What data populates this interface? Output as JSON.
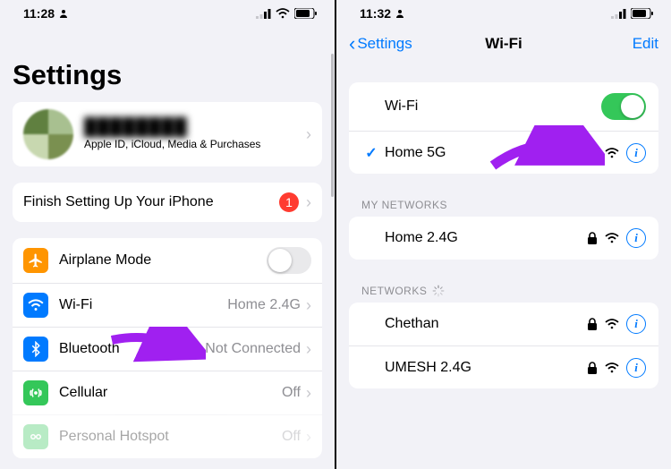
{
  "left": {
    "status": {
      "time": "11:28"
    },
    "title": "Settings",
    "profile": {
      "name": "████████",
      "subtitle": "Apple ID, iCloud, Media & Purchases"
    },
    "finish_setup": {
      "label": "Finish Setting Up Your iPhone",
      "badge": "1"
    },
    "rows": {
      "airplane": {
        "label": "Airplane Mode"
      },
      "wifi": {
        "label": "Wi-Fi",
        "detail": "Home 2.4G"
      },
      "bluetooth": {
        "label": "Bluetooth",
        "detail": "Not Connected"
      },
      "cellular": {
        "label": "Cellular",
        "detail": "Off"
      },
      "hotspot": {
        "label": "Personal Hotspot",
        "detail": "Off"
      }
    }
  },
  "right": {
    "status": {
      "time": "11:32"
    },
    "nav": {
      "back": "Settings",
      "title": "Wi-Fi",
      "edit": "Edit"
    },
    "wifi_toggle_label": "Wi-Fi",
    "connected": {
      "name": "Home 5G"
    },
    "sections": {
      "my_networks": {
        "header": "MY NETWORKS",
        "items": [
          {
            "name": "Home 2.4G"
          }
        ]
      },
      "other_networks": {
        "header": "NETWORKS",
        "items": [
          {
            "name": "Chethan"
          },
          {
            "name": "UMESH 2.4G"
          }
        ]
      }
    }
  }
}
